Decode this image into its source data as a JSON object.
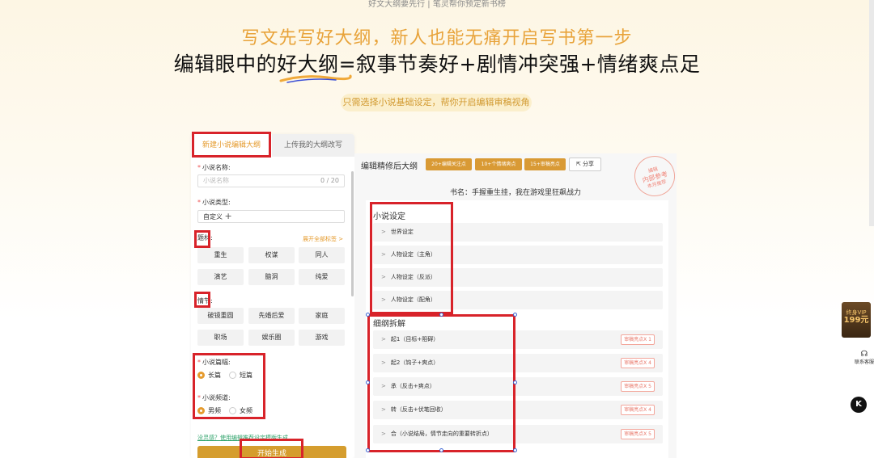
{
  "top_tagline": "好文大纲要先行 | 笔灵帮你预定新书榜",
  "hero": {
    "line1": "写文先写好大纲，新人也能无痛开启写书第一步",
    "line2": "编辑眼中的好大纲=叙事节奏好+剧情冲突强+情绪爽点足"
  },
  "pill_text": "只需选择小说基础设定，帮你开启编辑审稿视角",
  "left_panel": {
    "tabs": [
      "新建小说编辑大纲",
      "上传我的大纲改写"
    ],
    "name_label": "小说名称:",
    "name_placeholder": "小说名称",
    "name_counter": "0 / 20",
    "type_label": "小说类型:",
    "type_tag": "自定义",
    "theme_label": "题材:",
    "theme_link": "展开全部标签 >",
    "themes": [
      "重生",
      "权谋",
      "同人",
      "演艺",
      "脑洞",
      "纯爱"
    ],
    "plot_label": "情节:",
    "plots": [
      "破镜重圆",
      "先婚后爱",
      "家庭",
      "职场",
      "娱乐圈",
      "游戏"
    ],
    "length_label": "小说篇幅:",
    "length_options": [
      "长篇",
      "短篇"
    ],
    "channel_label": "小说频道:",
    "channel_options": [
      "男频",
      "女频"
    ],
    "helper_link": "没灵感？使用编辑推荐设定模版生成",
    "generate_button": "开始生成"
  },
  "right_panel": {
    "title": "编辑精修后大纲",
    "badges": [
      "20+编辑关注点",
      "10+个情绪爽点",
      "15+审稿亮点"
    ],
    "share": "分享",
    "stamp_top": "编辑",
    "stamp_main": "内部参考",
    "stamp_bottom": "本月推荐",
    "book_name": "书名：手握重生挂，我在游戏里狂飙战力",
    "settings_heading": "小说设定",
    "settings": [
      "世界设定",
      "人物设定（主角）",
      "人物设定（反派）",
      "人物设定（配角）"
    ],
    "outline_heading": "细纲拆解",
    "outline": [
      {
        "label": "起1（目标+阻碍）",
        "tag": "审稿亮点X 1"
      },
      {
        "label": "起2（钩子+爽点）",
        "tag": "审稿亮点X 4"
      },
      {
        "label": "承（反击+爽点）",
        "tag": "审稿亮点X 5"
      },
      {
        "label": "转（反击+伏笔回收）",
        "tag": "审稿亮点X 4"
      },
      {
        "label": "合（小说结局，情节走向的重要转折点）",
        "tag": "审稿亮点X 5"
      }
    ]
  },
  "side": {
    "vip_top": "终身VIP",
    "vip_price": "199元",
    "service": "联系客服",
    "k_button": "K"
  },
  "colors": {
    "accent": "#e59b2e",
    "highlight_box": "#d8232a",
    "hero_orange": "#e8a33a"
  }
}
